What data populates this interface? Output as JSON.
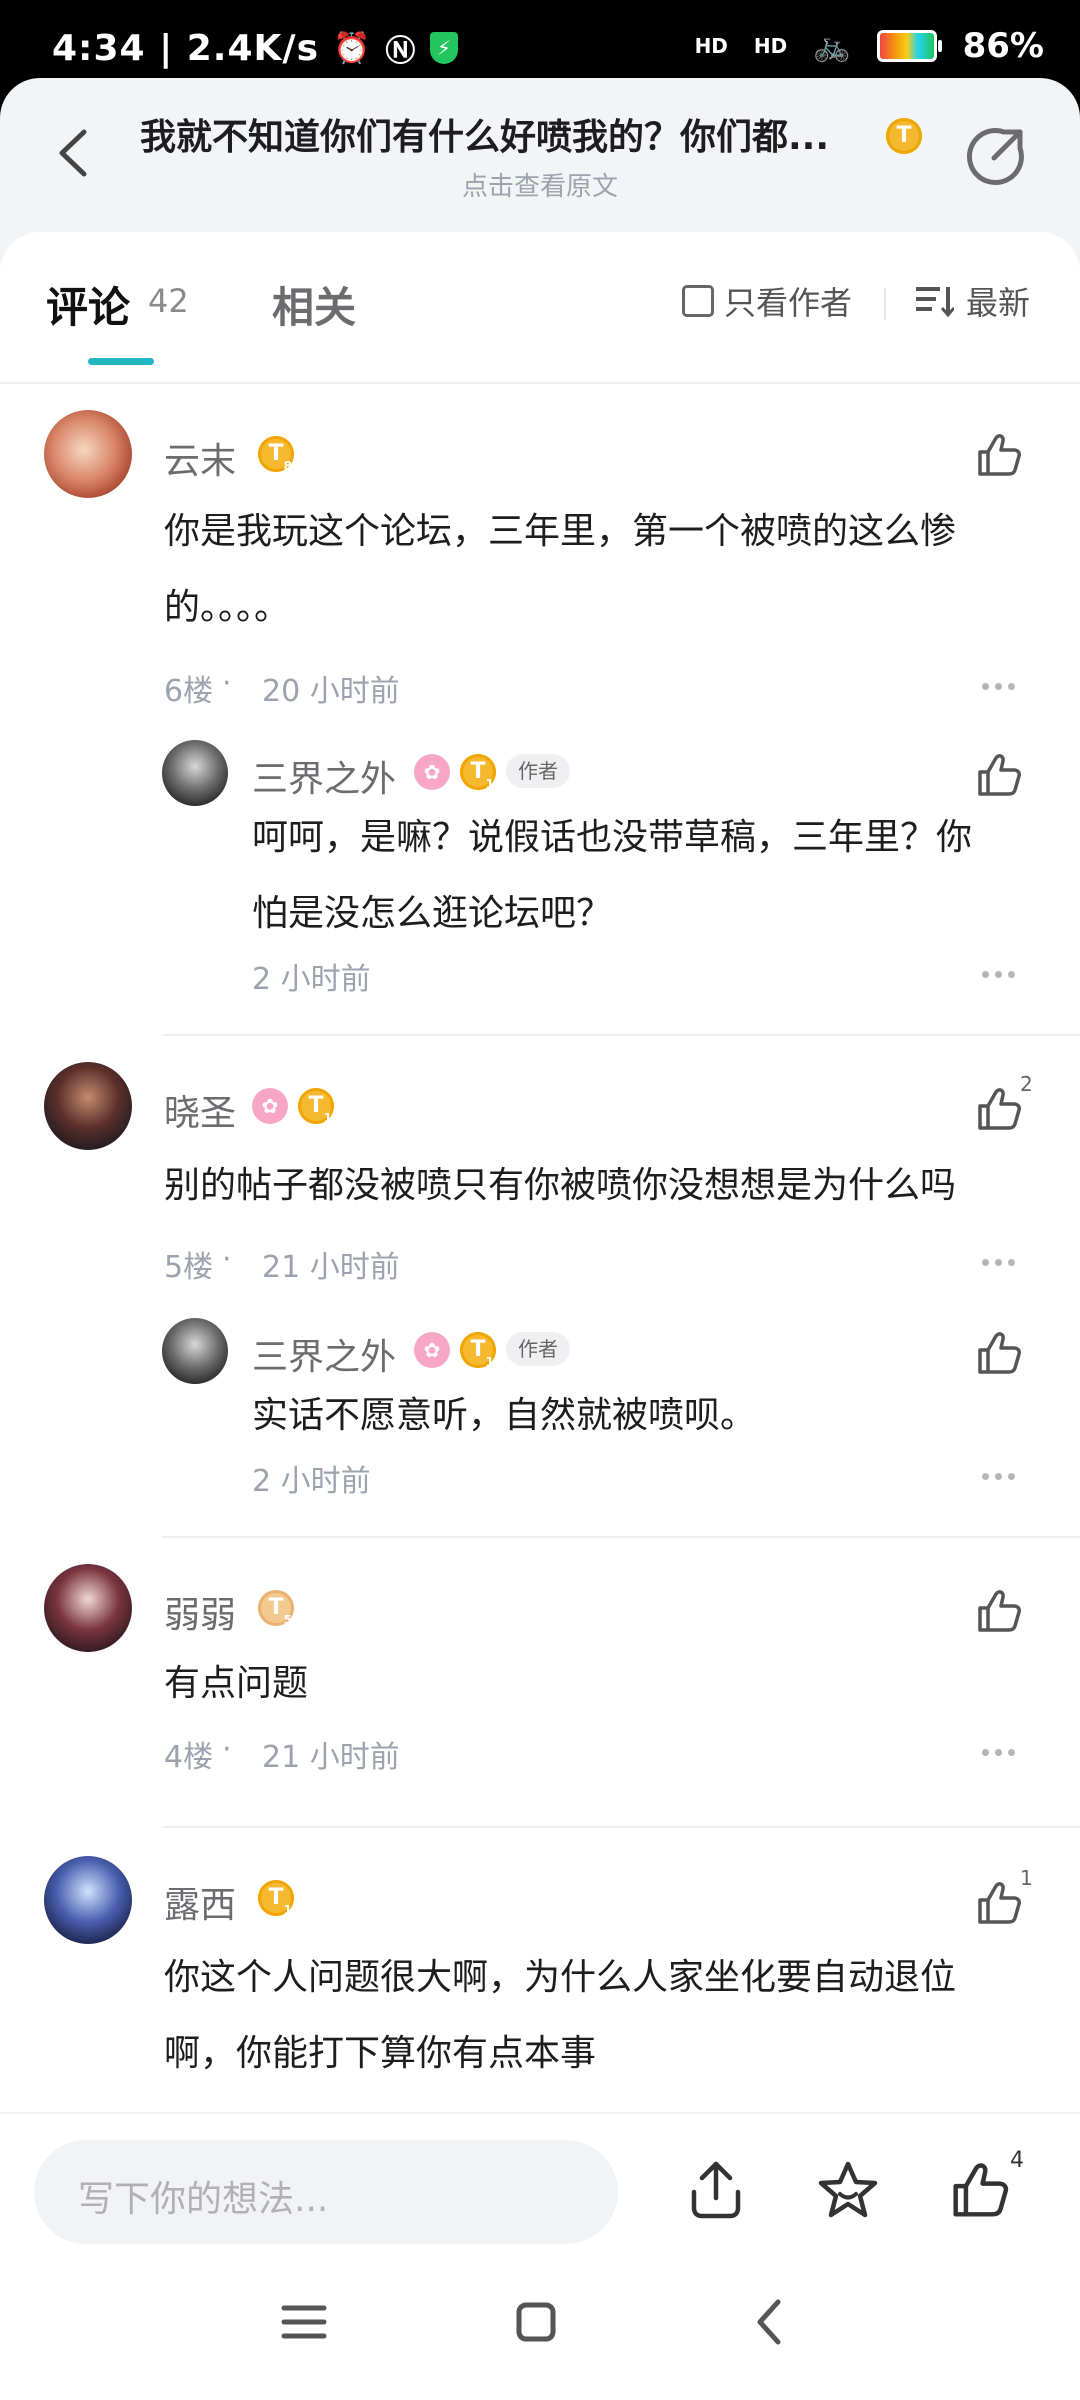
{
  "status_bar": {
    "time_speed": "4:34 | 2.4K/s",
    "hd1": "HD",
    "hd2": "HD",
    "battery": "86%"
  },
  "header": {
    "title": "我就不知道你们有什么好喷我的？你们都...",
    "title_badge": "T",
    "subtitle": "点击查看原文"
  },
  "tabs": {
    "comment_label": "评论",
    "comment_count": "42",
    "related_label": "相关",
    "author_only_label": "只看作者",
    "sort_label": "最新"
  },
  "comments": [
    {
      "username": "云末",
      "level": "T",
      "level_sub": "8",
      "text_line1": "你是我玩这个论坛，三年里，第一个被喷的这么惨",
      "text_line2": "的。。。。",
      "floor": "6楼",
      "time": "20 小时前",
      "reply": {
        "username": "三界之外",
        "level": "T",
        "level_sub": "1",
        "author_tag": "作者",
        "text_line1": "呵呵，是嘛？说假话也没带草稿，三年里？你",
        "text_line2": "怕是没怎么逛论坛吧？",
        "time": "2 小时前"
      }
    },
    {
      "username": "晓圣",
      "level": "T",
      "level_sub": "1",
      "like_count": "2",
      "text_line1": "别的帖子都没被喷只有你被喷你没想想是为什么吗",
      "floor": "5楼",
      "time": "21 小时前",
      "reply": {
        "username": "三界之外",
        "level": "T",
        "level_sub": "1",
        "author_tag": "作者",
        "text_line1": "实话不愿意听，自然就被喷呗。",
        "time": "2 小时前"
      }
    },
    {
      "username": "弱弱",
      "level": "T",
      "level_sub": "5",
      "text_line1": "有点问题",
      "floor": "4楼",
      "time": "21 小时前"
    },
    {
      "username": "露西",
      "level": "T",
      "level_sub": "1",
      "like_count": "1",
      "text_line1": "你这个人问题很大啊，为什么人家坐化要自动退位",
      "text_line2": "啊，你能打下算你有点本事"
    }
  ],
  "bottom_bar": {
    "input_placeholder": "写下你的想法...",
    "like_count": "4"
  },
  "colors": {
    "accent": "#22b5c2",
    "level_gold": "#f5b82e",
    "pink_badge": "#f7a7c5"
  }
}
